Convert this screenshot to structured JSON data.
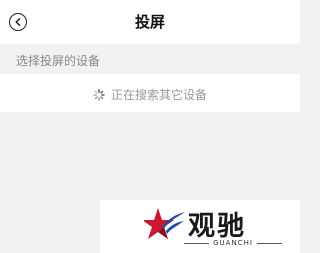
{
  "header": {
    "title": "投屏",
    "back_icon": "chevron-left-icon"
  },
  "devices": {
    "section_label": "选择投屏的设备",
    "status_text": "正在搜索其它设备",
    "status_icon": "loading-spinner-icon"
  },
  "watermark": {
    "brand_cn": "观驰",
    "brand_en": "GUANCHI",
    "colors": {
      "star_red": "#c8192f",
      "star_blue": "#1d4fa8"
    }
  }
}
